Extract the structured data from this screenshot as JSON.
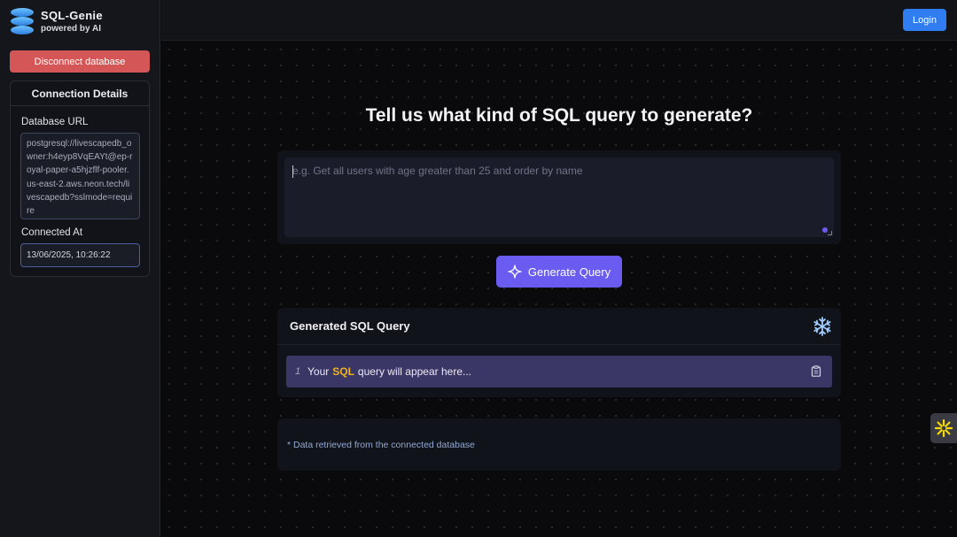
{
  "brand": {
    "title": "SQL-Genie",
    "subtitle": "powered by AI",
    "icon": "database-icon"
  },
  "sidebar": {
    "disconnect_label": "Disconnect database",
    "connection": {
      "title": "Connection Details",
      "url_label": "Database URL",
      "url_value": "postgresql://livescapedb_owner:h4eyp8VqEAYt@ep-royal-paper-a5hjzflf-pooler.us-east-2.aws.neon.tech/livescapedb?sslmode=require",
      "connected_label": "Connected At",
      "connected_value": "13/06/2025, 10:26:22"
    }
  },
  "topbar": {
    "login_label": "Login"
  },
  "main": {
    "heading": "Tell us what kind of SQL query to generate?",
    "input_placeholder": "e.g. Get all users with age greater than 25 and order by name",
    "generate_label": "Generate Query",
    "generate_icon": "sparkle-icon",
    "result": {
      "title": "Generated SQL Query",
      "header_icon": "snowflake-icon",
      "line_number": "1",
      "placeholder_pre": "Your",
      "placeholder_keyword": "SQL",
      "placeholder_post": "query will appear here...",
      "copy_icon": "clipboard-icon"
    },
    "note": "* Data retrieved from the connected database"
  },
  "colors": {
    "accent": "#6a5cf0",
    "login": "#2f7df0",
    "danger": "#d45656",
    "sql_keyword": "#f1b21f",
    "widget_icon": "#f5d90a"
  }
}
